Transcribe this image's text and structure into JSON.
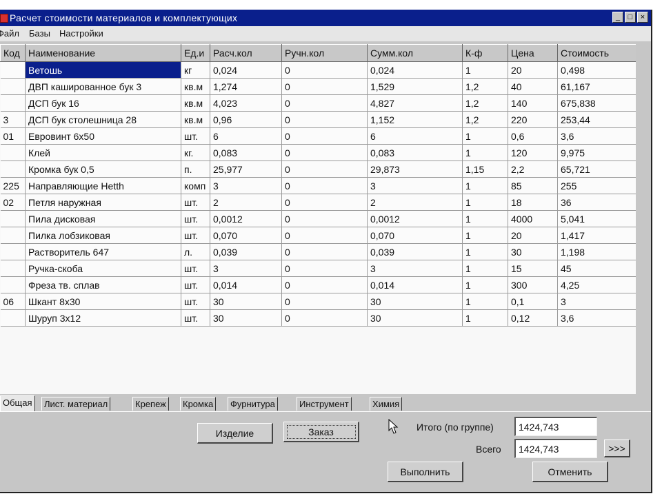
{
  "window": {
    "title": "Расчет стоимости материалов и комплектующих",
    "controls": {
      "minimize": "_",
      "maximize": "□",
      "close": "×"
    }
  },
  "menu": [
    "Файл",
    "Базы",
    "Настройки"
  ],
  "grid": {
    "columns": [
      "Код",
      "Наименование",
      "Ед.и",
      "Расч.кол",
      "Ручн.кол",
      "Сумм.кол",
      "К-ф",
      "Цена",
      "Стоимость"
    ],
    "rows": [
      [
        "",
        "Ветошь",
        "кг",
        "0,024",
        "0",
        "0,024",
        "1",
        "20",
        "0,498"
      ],
      [
        "",
        "ДВП кашированное бук 3",
        "кв.м",
        "1,274",
        "0",
        "1,529",
        "1,2",
        "40",
        "61,167"
      ],
      [
        "",
        "ДСП бук 16",
        "кв.м",
        "4,023",
        "0",
        "4,827",
        "1,2",
        "140",
        "675,838"
      ],
      [
        "3",
        "ДСП бук столешница 28",
        "кв.м",
        "0,96",
        "0",
        "1,152",
        "1,2",
        "220",
        "253,44"
      ],
      [
        "01",
        "Евровинт 6х50",
        "шт.",
        "6",
        "0",
        "6",
        "1",
        "0,6",
        "3,6"
      ],
      [
        "",
        "Клей",
        "кг.",
        "0,083",
        "0",
        "0,083",
        "1",
        "120",
        "9,975"
      ],
      [
        "",
        "Кромка бук 0,5",
        "п.",
        "25,977",
        "0",
        "29,873",
        "1,15",
        "2,2",
        "65,721"
      ],
      [
        "225",
        "Направляющие Hetth",
        "комп",
        "3",
        "0",
        "3",
        "1",
        "85",
        "255"
      ],
      [
        "02",
        "Петля наружная",
        "шт.",
        "2",
        "0",
        "2",
        "1",
        "18",
        "36"
      ],
      [
        "",
        "Пила дисковая",
        "шт.",
        "0,0012",
        "0",
        "0,0012",
        "1",
        "4000",
        "5,041"
      ],
      [
        "",
        "Пилка лобзиковая",
        "шт.",
        "0,070",
        "0",
        "0,070",
        "1",
        "20",
        "1,417"
      ],
      [
        "",
        "Растворитель 647",
        "л.",
        "0,039",
        "0",
        "0,039",
        "1",
        "30",
        "1,198"
      ],
      [
        "",
        "Ручка-скоба",
        "шт.",
        "3",
        "0",
        "3",
        "1",
        "15",
        "45"
      ],
      [
        "",
        "Фреза тв. сплав",
        "шт.",
        "0,014",
        "0",
        "0,014",
        "1",
        "300",
        "4,25"
      ],
      [
        "06",
        "Шкант 8х30",
        "шт.",
        "30",
        "0",
        "30",
        "1",
        "0,1",
        "3"
      ],
      [
        "",
        "Шуруп 3х12",
        "шт.",
        "30",
        "0",
        "30",
        "1",
        "0,12",
        "3,6"
      ]
    ],
    "selected": "Ветошь"
  },
  "tabs": [
    "Общая",
    "Лист. материал",
    "Крепеж",
    "Кромка",
    "Фурнитура",
    "Инструмент",
    "Химия"
  ],
  "buttons": {
    "product": "Изделие",
    "order": "Заказ",
    "more": ">>>",
    "execute": "Выполнить",
    "cancel": "Отменить"
  },
  "totals": {
    "group_label": "Итого (по группе)",
    "group_value": "1424,743",
    "all_label": "Всего",
    "all_value": "1424,743"
  },
  "colors": {
    "titlebar": "#0a1f8c",
    "selection": "#0a1f8c",
    "window_bg": "#c6c6c6"
  }
}
